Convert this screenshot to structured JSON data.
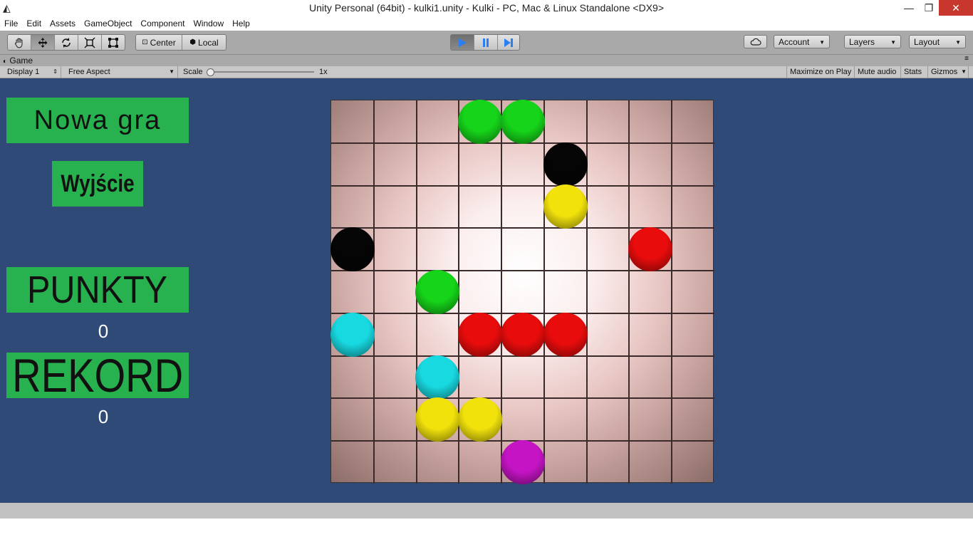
{
  "window": {
    "title": "Unity Personal (64bit) - kulki1.unity - Kulki - PC, Mac & Linux Standalone <DX9>",
    "min": "—",
    "restore": "❐",
    "close": "✕"
  },
  "menu": [
    "File",
    "Edit",
    "Assets",
    "GameObject",
    "Component",
    "Window",
    "Help"
  ],
  "toolbar": {
    "pivot": "Center",
    "space": "Local",
    "account": "Account",
    "layers": "Layers",
    "layout": "Layout"
  },
  "game_tab": {
    "label": "Game"
  },
  "game_bar": {
    "display": "Display 1",
    "aspect": "Free Aspect",
    "scale_label": "Scale",
    "scale_value": "1x",
    "maximize": "Maximize on Play",
    "mute": "Mute audio",
    "stats": "Stats",
    "gizmos": "Gizmos"
  },
  "game_ui": {
    "new_game": "Nowa gra",
    "exit": "Wyjście",
    "points_label": "PUNKTY",
    "points_value": "0",
    "record_label": "REKORD",
    "record_value": "0"
  },
  "board": {
    "rows": 9,
    "cols": 9,
    "balls": [
      {
        "row": 0,
        "col": 3,
        "color": "#16d41a"
      },
      {
        "row": 0,
        "col": 4,
        "color": "#16d41a"
      },
      {
        "row": 1,
        "col": 5,
        "color": "#050505"
      },
      {
        "row": 2,
        "col": 5,
        "color": "#f2e20c"
      },
      {
        "row": 3,
        "col": 0,
        "color": "#050505"
      },
      {
        "row": 3,
        "col": 7,
        "color": "#e80c0c"
      },
      {
        "row": 4,
        "col": 2,
        "color": "#16d41a"
      },
      {
        "row": 5,
        "col": 0,
        "color": "#18d8e0"
      },
      {
        "row": 5,
        "col": 3,
        "color": "#e80c0c"
      },
      {
        "row": 5,
        "col": 4,
        "color": "#e80c0c"
      },
      {
        "row": 5,
        "col": 5,
        "color": "#e80c0c"
      },
      {
        "row": 6,
        "col": 2,
        "color": "#18d8e0"
      },
      {
        "row": 7,
        "col": 2,
        "color": "#f2e20c"
      },
      {
        "row": 7,
        "col": 3,
        "color": "#f2e20c"
      },
      {
        "row": 8,
        "col": 4,
        "color": "#c414c4"
      }
    ]
  }
}
